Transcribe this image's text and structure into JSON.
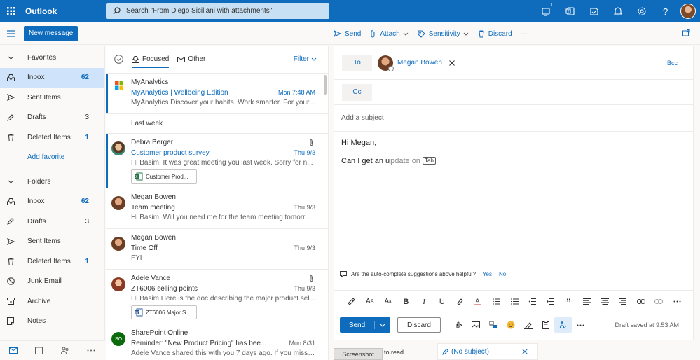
{
  "app": {
    "title": "Outlook"
  },
  "search": {
    "text": "Search \"From Diego Siciliani with attachments\""
  },
  "topbar": {
    "notification_badge": "1"
  },
  "commands": {
    "new_message": "New message",
    "send": "Send",
    "attach": "Attach",
    "sensitivity": "Sensitivity",
    "discard": "Discard",
    "more": "···"
  },
  "nav": {
    "favorites_label": "Favorites",
    "favorites": [
      {
        "label": "Inbox",
        "count": "62",
        "icon": "inbox-icon",
        "selected": true,
        "count_style": "blue"
      },
      {
        "label": "Sent Items",
        "count": "",
        "icon": "send-icon"
      },
      {
        "label": "Drafts",
        "count": "3",
        "icon": "pencil-icon",
        "count_style": "grey"
      },
      {
        "label": "Deleted Items",
        "count": "1",
        "icon": "trash-icon",
        "count_style": "blue"
      }
    ],
    "add_favorite": "Add favorite",
    "folders_label": "Folders",
    "folders": [
      {
        "label": "Inbox",
        "count": "62",
        "icon": "inbox-icon",
        "count_style": "blue"
      },
      {
        "label": "Drafts",
        "count": "3",
        "icon": "pencil-icon",
        "count_style": "grey"
      },
      {
        "label": "Sent Items",
        "count": "",
        "icon": "send-icon"
      },
      {
        "label": "Deleted Items",
        "count": "1",
        "icon": "trash-icon",
        "count_style": "blue"
      },
      {
        "label": "Junk Email",
        "count": "",
        "icon": "block-icon"
      },
      {
        "label": "Archive",
        "count": "",
        "icon": "archive-icon"
      },
      {
        "label": "Notes",
        "count": "",
        "icon": "note-icon"
      }
    ]
  },
  "list": {
    "tab_focused": "Focused",
    "tab_other": "Other",
    "filter": "Filter",
    "section_last_week": "Last week",
    "messages": [
      {
        "sender": "MyAnalytics",
        "subject": "MyAnalytics | Wellbeing Edition",
        "date": "Mon 7:48 AM",
        "preview": "MyAnalytics Discover your habits. Work smarter. For your...",
        "unread": true
      },
      {
        "sender": "Debra Berger",
        "subject": "Customer product survey",
        "date": "Thu 9/3",
        "preview": "Hi Basim, It was great meeting you last week. Sorry for n...",
        "attachment": "Customer Prod...",
        "unread": true
      },
      {
        "sender": "Megan Bowen",
        "subject": "Team meeting",
        "date": "Thu 9/3",
        "preview": "Hi Basim, Will you need me for the team meeting tomorr..."
      },
      {
        "sender": "Megan Bowen",
        "subject": "Time Off",
        "date": "Thu 9/3",
        "preview": "FYI"
      },
      {
        "sender": "Adele Vance",
        "subject": "ZT6006 selling points",
        "date": "Thu 9/3",
        "preview": "Hi Basim Here is the doc describing the major product sel...",
        "attachment": "ZT6006 Major S..."
      },
      {
        "sender": "SharePoint Online",
        "initials": "SO",
        "subject": "Reminder: \"New Product Pricing\" has bee...",
        "date": "Mon 8/31",
        "preview": "Adele Vance shared this with you 7 days ago. If you misse..."
      }
    ]
  },
  "compose": {
    "to_label": "To",
    "recipient": "Megan Bowen",
    "bcc_label": "Bcc",
    "cc_label": "Cc",
    "subject_placeholder": "Add a subject",
    "greeting": "Hi Megan,",
    "typed_text": "Can I get an u",
    "suggestion_text": "pdate on",
    "tab_key": "Tab",
    "feedback_question": "Are the auto-complete suggestions above helpful?",
    "feedback_yes": "Yes",
    "feedback_no": "No",
    "send_label": "Send",
    "discard_label": "Discard",
    "draft_status": "Draft saved at 9:53 AM"
  },
  "tray": {
    "screenshot_label": "Screenshot",
    "to_read": "to read",
    "draft_tab": "(No subject)"
  },
  "colors": {
    "accent": "#0f6cbd",
    "selected_bg": "#cfe4fa"
  }
}
